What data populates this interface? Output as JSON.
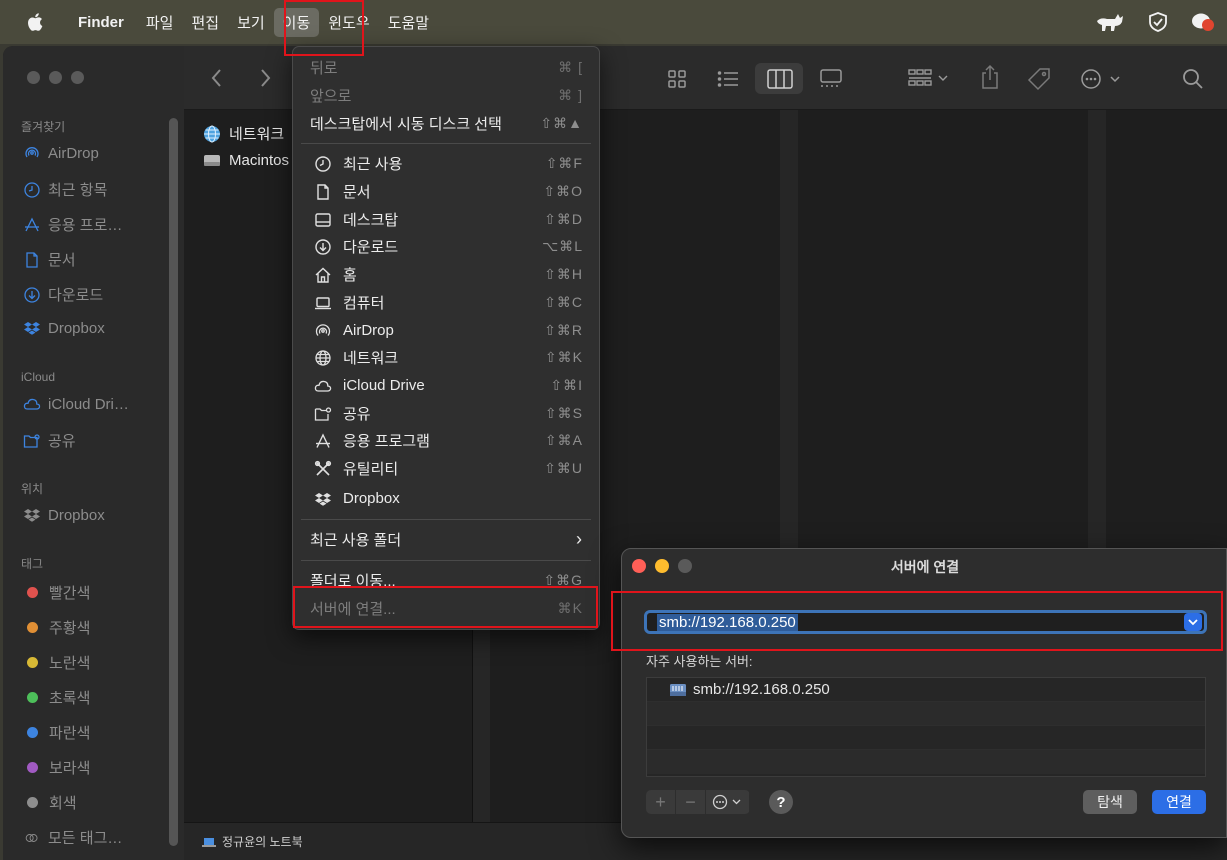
{
  "menubar": {
    "app_name": "Finder",
    "items": [
      "파일",
      "편집",
      "보기",
      "이동",
      "윈도우",
      "도움말"
    ]
  },
  "sidebar": {
    "favorites_title": "즐겨찾기",
    "favorites": [
      "AirDrop",
      "최근 항목",
      "응용 프로…",
      "문서",
      "다운로드",
      "Dropbox"
    ],
    "icloud_title": "iCloud",
    "icloud": [
      "iCloud Dri…",
      "공유"
    ],
    "locations_title": "위치",
    "locations": [
      "Dropbox"
    ],
    "tags_title": "태그",
    "tags": [
      {
        "label": "빨간색",
        "color": "#e0524e"
      },
      {
        "label": "주황색",
        "color": "#e08f35"
      },
      {
        "label": "노란색",
        "color": "#d8b935"
      },
      {
        "label": "초록색",
        "color": "#4dbf5a"
      },
      {
        "label": "파란색",
        "color": "#3d84e0"
      },
      {
        "label": "보라색",
        "color": "#a15ac2"
      },
      {
        "label": "회색",
        "color": "#8e8e8e"
      },
      {
        "label": "모든 태그…",
        "color": ""
      }
    ]
  },
  "files": [
    "네트워크",
    "Macintos"
  ],
  "pathbar": {
    "label": "정규윤의 노트북"
  },
  "go_menu": {
    "back": {
      "label": "뒤로",
      "shortcut": "⌘ ["
    },
    "forward": {
      "label": "앞으로",
      "shortcut": "⌘ ]"
    },
    "startup": {
      "label": "데스크탑에서 시동 디스크 선택",
      "shortcut": "⇧⌘▲"
    },
    "places": [
      {
        "label": "최근 사용",
        "shortcut": "⇧⌘F",
        "icon": "clock-icon"
      },
      {
        "label": "문서",
        "shortcut": "⇧⌘O",
        "icon": "document-icon"
      },
      {
        "label": "데스크탑",
        "shortcut": "⇧⌘D",
        "icon": "desktop-icon"
      },
      {
        "label": "다운로드",
        "shortcut": "⌥⌘L",
        "icon": "download-icon"
      },
      {
        "label": "홈",
        "shortcut": "⇧⌘H",
        "icon": "home-icon"
      },
      {
        "label": "컴퓨터",
        "shortcut": "⇧⌘C",
        "icon": "laptop-icon"
      },
      {
        "label": "AirDrop",
        "shortcut": "⇧⌘R",
        "icon": "airdrop-icon"
      },
      {
        "label": "네트워크",
        "shortcut": "⇧⌘K",
        "icon": "network-icon"
      },
      {
        "label": "iCloud Drive",
        "shortcut": "⇧⌘I",
        "icon": "cloud-icon"
      },
      {
        "label": "공유",
        "shortcut": "⇧⌘S",
        "icon": "shared-folder-icon"
      },
      {
        "label": "응용 프로그램",
        "shortcut": "⇧⌘A",
        "icon": "applications-icon"
      },
      {
        "label": "유틸리티",
        "shortcut": "⇧⌘U",
        "icon": "utilities-icon"
      },
      {
        "label": "Dropbox",
        "shortcut": "",
        "icon": "dropbox-icon"
      }
    ],
    "recent_folders": {
      "label": "최근 사용 폴더",
      "shortcut": "›"
    },
    "goto_folder": {
      "label": "폴더로 이동...",
      "shortcut": "⇧⌘G"
    },
    "connect_server": {
      "label": "서버에 연결...",
      "shortcut": "⌘K"
    }
  },
  "dialog": {
    "title": "서버에 연결",
    "address": "smb://192.168.0.250",
    "favorites_label": "자주 사용하는 서버:",
    "favorites": [
      "smb://192.168.0.250"
    ],
    "browse_label": "탐색",
    "connect_label": "연결",
    "help_label": "?"
  },
  "colors": {
    "accent": "#2c6ee6",
    "highlight": "#e0141b"
  }
}
